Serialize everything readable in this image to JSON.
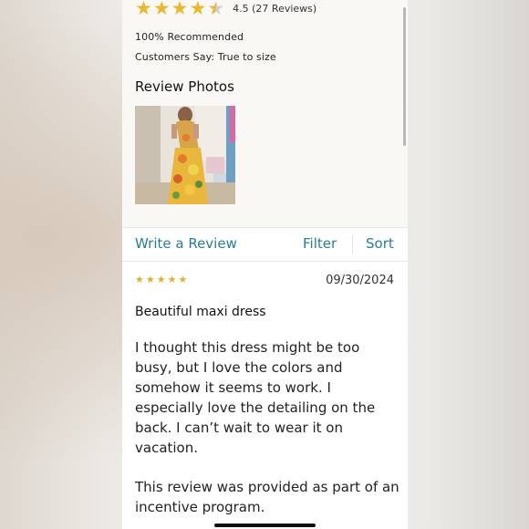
{
  "summary": {
    "stars": [
      "full",
      "full",
      "full",
      "full",
      "half"
    ],
    "rating_value": 4.5,
    "rating_text": "4.5 (27 Reviews)",
    "recommended": "100% Recommended",
    "customers_say": "Customers Say: True to size",
    "photos_title": "Review Photos"
  },
  "actions": {
    "write_review": "Write a Review",
    "filter": "Filter",
    "sort": "Sort"
  },
  "review": {
    "rating": 5,
    "date": "09/30/2024",
    "title": "Beautiful maxi dress",
    "body": "I thought this dress might be too busy, but I love the colors and somehow it seems to work. I especially love the detailing on the back. I can’t wait to wear it on vacation.",
    "note": "This review was provided as part of an incentive program."
  },
  "colors": {
    "star": "#e8b92e",
    "link": "#2a7d8f"
  },
  "icons": {
    "star": "star-icon",
    "half_star": "half-star-icon"
  }
}
